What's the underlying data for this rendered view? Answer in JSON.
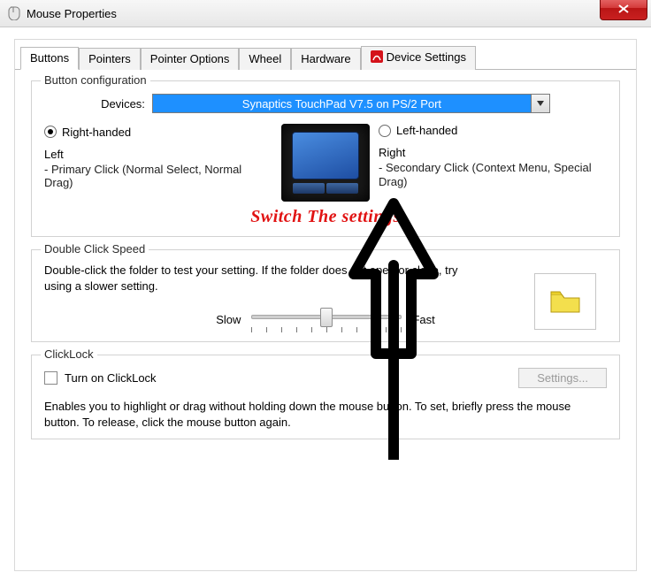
{
  "window": {
    "title": "Mouse Properties",
    "close": "X"
  },
  "tabs": [
    {
      "id": "buttons",
      "label": "Buttons",
      "active": true
    },
    {
      "id": "pointers",
      "label": "Pointers"
    },
    {
      "id": "pointer-options",
      "label": "Pointer Options"
    },
    {
      "id": "wheel",
      "label": "Wheel"
    },
    {
      "id": "hardware",
      "label": "Hardware"
    },
    {
      "id": "device-settings",
      "label": "Device Settings",
      "icon": "synaptics-icon"
    }
  ],
  "button_config": {
    "legend": "Button configuration",
    "devices_label": "Devices:",
    "device_selected": "Synaptics TouchPad V7.5 on PS/2 Port",
    "right_handed": {
      "label": "Right-handed",
      "checked": true
    },
    "left_handed": {
      "label": "Left-handed",
      "checked": false
    },
    "left_col": {
      "title": "Left",
      "desc": " - Primary Click (Normal Select, Normal Drag)"
    },
    "right_col": {
      "title": "Right",
      "desc": " - Secondary Click (Context Menu, Special Drag)"
    },
    "annotation": "Switch The settings"
  },
  "double_click": {
    "legend": "Double Click Speed",
    "text": "Double-click the folder to test your setting. If the folder does not open or close, try using a slower setting.",
    "slow": "Slow",
    "fast": "Fast",
    "value_percent": 50
  },
  "clicklock": {
    "legend": "ClickLock",
    "checkbox_label": "Turn on ClickLock",
    "checked": false,
    "settings_button": "Settings...",
    "description": "Enables you to highlight or drag without holding down the mouse button.  To set, briefly press the mouse button.  To release, click the mouse button again."
  }
}
